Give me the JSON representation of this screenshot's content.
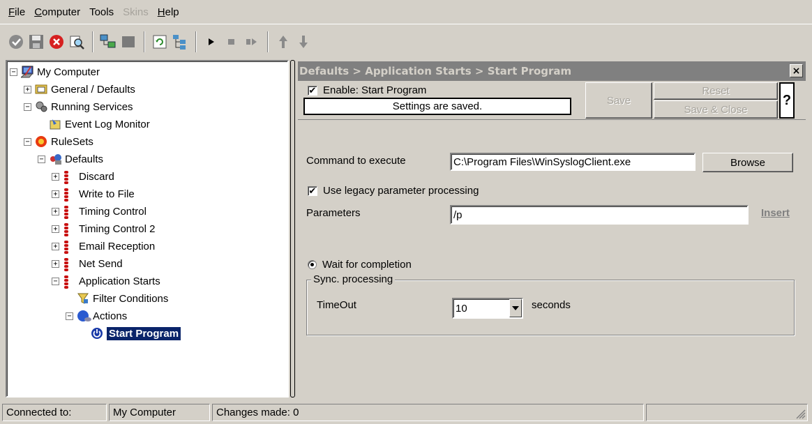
{
  "menu": [
    {
      "label": "File",
      "underline": "F",
      "rest": "ile",
      "disabled": false
    },
    {
      "label": "Computer",
      "underline": "C",
      "rest": "omputer",
      "disabled": false
    },
    {
      "label": "Tools",
      "underline": "",
      "rest": "Tools",
      "disabled": false
    },
    {
      "label": "Skins",
      "underline": "",
      "rest": "Skins",
      "disabled": true
    },
    {
      "label": "Help",
      "underline": "H",
      "rest": "elp",
      "disabled": false
    }
  ],
  "toolbar_icons": [
    "check-circle-icon",
    "save-icon",
    "cancel-icon",
    "search-icon",
    "network-icon",
    "stop-square-icon",
    "refresh-icon",
    "tree-icon",
    "play-icon",
    "stop-icon",
    "step-icon",
    "move-up-icon",
    "move-down-icon"
  ],
  "tree": [
    {
      "label": "My Computer",
      "icon": "computer-icon",
      "expander": "−",
      "depth": 0
    },
    {
      "label": "General / Defaults",
      "icon": "folder-icon",
      "expander": "+",
      "depth": 1
    },
    {
      "label": "Running Services",
      "icon": "gears-icon",
      "expander": "−",
      "depth": 1
    },
    {
      "label": "Event Log Monitor",
      "icon": "event-log-icon",
      "expander": "",
      "depth": 2
    },
    {
      "label": "RuleSets",
      "icon": "ruleset-icon",
      "expander": "−",
      "depth": 1
    },
    {
      "label": "Defaults",
      "icon": "ruleset-defaults-icon",
      "expander": "−",
      "depth": 2
    },
    {
      "label": "Discard",
      "icon": "rule-icon",
      "expander": "+",
      "depth": 3
    },
    {
      "label": "Write to File",
      "icon": "rule-icon",
      "expander": "+",
      "depth": 3
    },
    {
      "label": "Timing Control",
      "icon": "rule-icon",
      "expander": "+",
      "depth": 3
    },
    {
      "label": "Timing Control 2",
      "icon": "rule-icon",
      "expander": "+",
      "depth": 3
    },
    {
      "label": "Email Reception",
      "icon": "rule-icon",
      "expander": "+",
      "depth": 3
    },
    {
      "label": "Net Send",
      "icon": "rule-icon",
      "expander": "+",
      "depth": 3
    },
    {
      "label": "Application Starts",
      "icon": "rule-icon",
      "expander": "−",
      "depth": 3
    },
    {
      "label": "Filter Conditions",
      "icon": "filter-icon",
      "expander": "",
      "depth": 4
    },
    {
      "label": "Actions",
      "icon": "actions-icon",
      "expander": "−",
      "depth": 4
    },
    {
      "label": "Start Program",
      "icon": "power-icon",
      "expander": "",
      "depth": 5,
      "selected": true
    }
  ],
  "panel": {
    "title": "Defaults > Application Starts > Start Program",
    "close": "×",
    "enable_label": "Enable: Start Program",
    "enable_checked": true,
    "status": "Settings are saved.",
    "save": "Save",
    "reset": "Reset",
    "save_close": "Save & Close",
    "help": "?",
    "command_label": "Command to execute",
    "command_value": "C:\\Program Files\\WinSyslogClient.exe",
    "browse": "Browse",
    "legacy_label": "Use legacy parameter processing",
    "legacy_checked": true,
    "parameters_label": "Parameters",
    "parameters_value": "/p",
    "insert": "Insert",
    "wait_label": "Wait for completion",
    "sync_legend": "Sync. processing",
    "timeout_label": "TimeOut",
    "timeout_value": "10",
    "seconds_label": "seconds"
  },
  "statusbar": {
    "connected_label": "Connected to:",
    "connected_value": "My Computer",
    "changes": "Changes made: 0"
  },
  "colors": {
    "face": "#d4d0c8",
    "selection": "#0a246a",
    "titlebar": "#808080"
  }
}
